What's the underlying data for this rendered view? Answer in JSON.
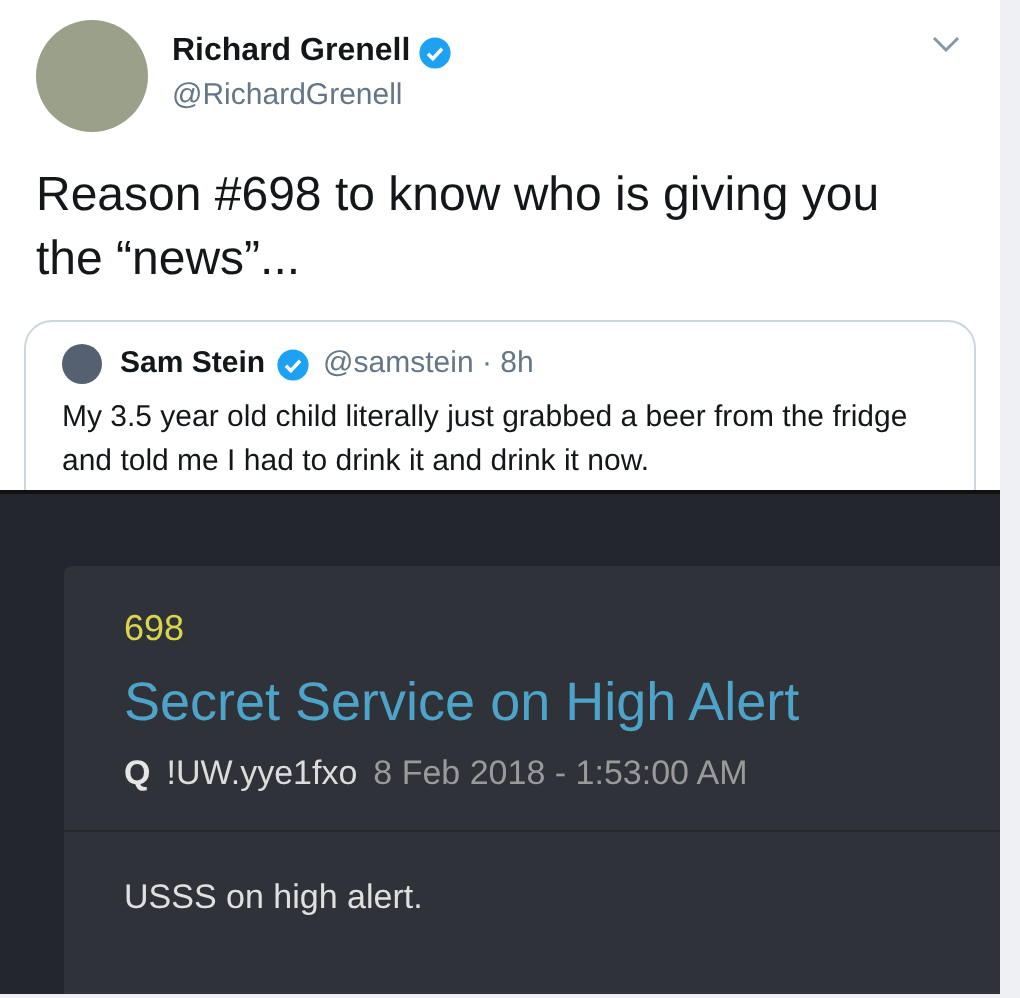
{
  "tweet": {
    "author": {
      "name": "Richard Grenell",
      "handle": "@RichardGrenell",
      "verified": true
    },
    "text": "Reason #698 to know who is giving you the “news”...",
    "quoted": {
      "name": "Sam Stein",
      "verified": true,
      "handle": "@samstein · 8h",
      "text": "My 3.5 year old child literally just grabbed a beer from the fridge and told me I had to drink it and drink it now."
    }
  },
  "post": {
    "number": "698",
    "title": "Secret Service on High Alert",
    "author": "Q",
    "tripcode": "!UW.yye1fxo",
    "date": "8 Feb 2018 - 1:53:00 AM",
    "body": "USSS on high alert."
  }
}
